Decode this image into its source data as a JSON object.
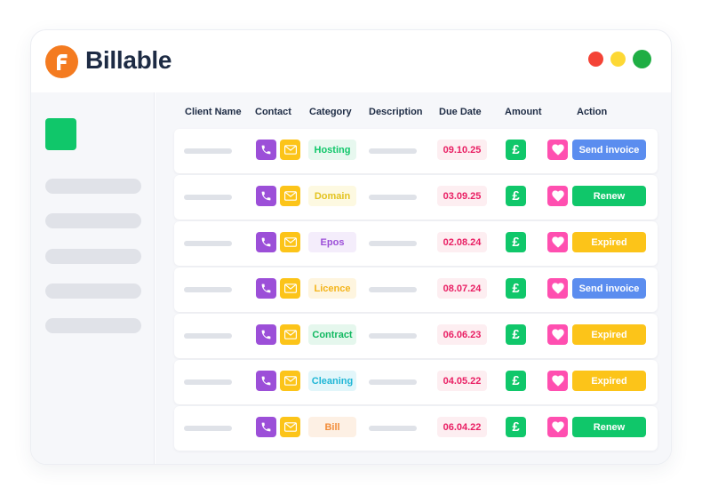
{
  "app": {
    "name": "Billable",
    "brand_color": "#f47b20"
  },
  "window_controls": [
    {
      "name": "close",
      "color": "#f44336"
    },
    {
      "name": "minimize",
      "color": "#fdd835"
    },
    {
      "name": "maximize",
      "color": "#1fae44"
    }
  ],
  "table": {
    "headers": {
      "client_name": "Client Name",
      "contact": "Contact",
      "category": "Category",
      "description": "Description",
      "due_date": "Due Date",
      "amount": "Amount",
      "action": "Action"
    },
    "rows": [
      {
        "category": "Hosting",
        "category_color": "#10c76a",
        "category_bg": "#e7f8ef",
        "due_date": "09.10.25",
        "action": "Send invoice",
        "action_color": "#5b8def"
      },
      {
        "category": "Domain",
        "category_color": "#e3c320",
        "category_bg": "#fdf9e1",
        "due_date": "03.09.25",
        "action": "Renew",
        "action_color": "#10c76a"
      },
      {
        "category": "Epos",
        "category_color": "#9c4fd8",
        "category_bg": "#f4edfb",
        "due_date": "02.08.24",
        "action": "Expired",
        "action_color": "#fcc419"
      },
      {
        "category": "Licence",
        "category_color": "#f4b41a",
        "category_bg": "#fef5df",
        "due_date": "08.07.24",
        "action": "Send invoice",
        "action_color": "#5b8def"
      },
      {
        "category": "Contract",
        "category_color": "#10b860",
        "category_bg": "#e5f7ed",
        "due_date": "06.06.23",
        "action": "Expired",
        "action_color": "#fcc419"
      },
      {
        "category": "Cleaning",
        "category_color": "#1fb6d6",
        "category_bg": "#e2f6fa",
        "due_date": "04.05.22",
        "action": "Expired",
        "action_color": "#fcc419"
      },
      {
        "category": "Bill",
        "category_color": "#f28c38",
        "category_bg": "#fdf0e4",
        "due_date": "06.04.22",
        "action": "Renew",
        "action_color": "#10c76a"
      }
    ]
  },
  "icons": {
    "contact_phone": "phone-icon",
    "contact_email": "envelope-icon",
    "amount": "pound-sign-icon",
    "favorite": "heart-icon",
    "amount_symbol": "£"
  }
}
